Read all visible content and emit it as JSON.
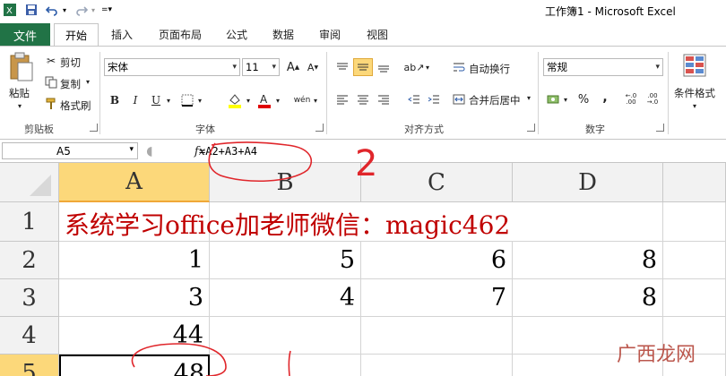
{
  "window": {
    "title": "工作簿1 - Microsoft Excel"
  },
  "tabs": {
    "file": "文件",
    "home": "开始",
    "insert": "插入",
    "page_layout": "页面布局",
    "formulas": "公式",
    "data": "数据",
    "review": "审阅",
    "view": "视图"
  },
  "ribbon": {
    "clipboard": {
      "paste": "粘贴",
      "cut": "剪切",
      "copy": "复制",
      "format_painter": "格式刷",
      "label": "剪贴板"
    },
    "font": {
      "name": "宋体",
      "size": "11",
      "bold": "B",
      "italic": "I",
      "underline": "U",
      "label": "字体"
    },
    "alignment": {
      "wrap_text": "自动换行",
      "merge_center": "合并后居中",
      "label": "对齐方式"
    },
    "number": {
      "format": "常规",
      "percent": "%",
      "comma": ",",
      "label": "数字"
    },
    "styles": {
      "conditional_format": "条件格式"
    }
  },
  "formula_bar": {
    "name_box": "A5",
    "fx": "fx",
    "formula": "=A2+A3+A4"
  },
  "annotations": {
    "formula_note": "2"
  },
  "sheet": {
    "columns": [
      "A",
      "B",
      "C",
      "D"
    ],
    "rows": [
      "1",
      "2",
      "3",
      "4",
      "5"
    ],
    "title_text": "系统学习office加老师微信：magic462",
    "cells": {
      "A2": "1",
      "B2": "5",
      "C2": "6",
      "D2": "8",
      "A3": "3",
      "B3": "4",
      "C3": "7",
      "D3": "8",
      "A4": "44",
      "A5": "48"
    }
  },
  "watermark": "广西龙网",
  "colors": {
    "file_tab": "#217346",
    "title_text": "#c00000",
    "annotation": "#e0262b"
  }
}
